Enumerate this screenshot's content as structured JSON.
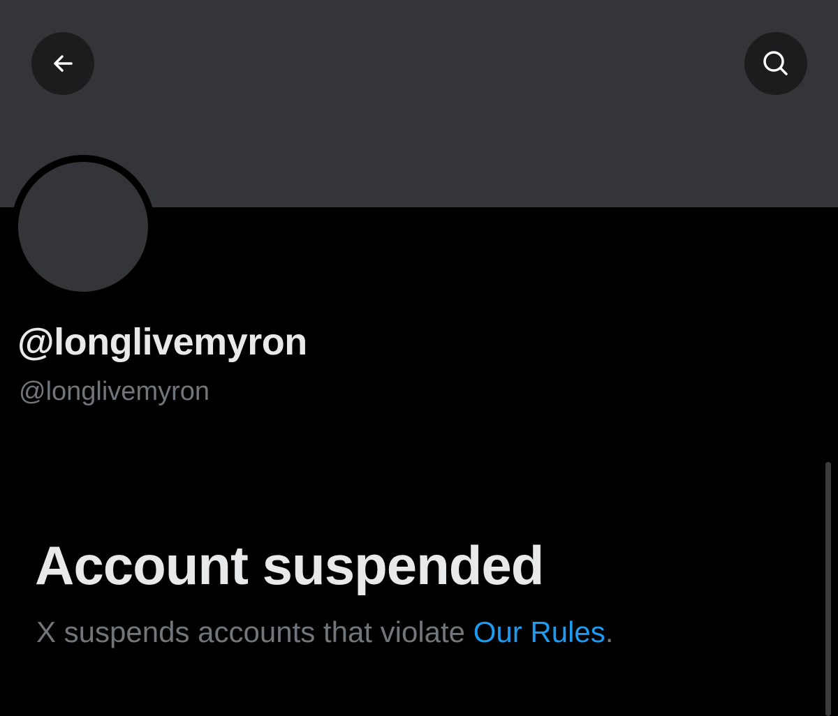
{
  "header": {
    "back_icon": "arrow-left-icon",
    "search_icon": "search-icon",
    "banner_color": "#333539",
    "button_bg": "#1b1c1e"
  },
  "profile": {
    "display_name": "@longlivemyron",
    "handle": "@longlivemyron",
    "avatar_color": "#333539"
  },
  "suspension": {
    "title": "Account suspended",
    "message_prefix": "X suspends accounts that violate ",
    "rules_link": "Our Rules",
    "message_suffix": "."
  },
  "colors": {
    "background": "#000000",
    "primary_text": "#e7e9ea",
    "secondary_text": "#71767b",
    "link": "#1d9bf0"
  }
}
